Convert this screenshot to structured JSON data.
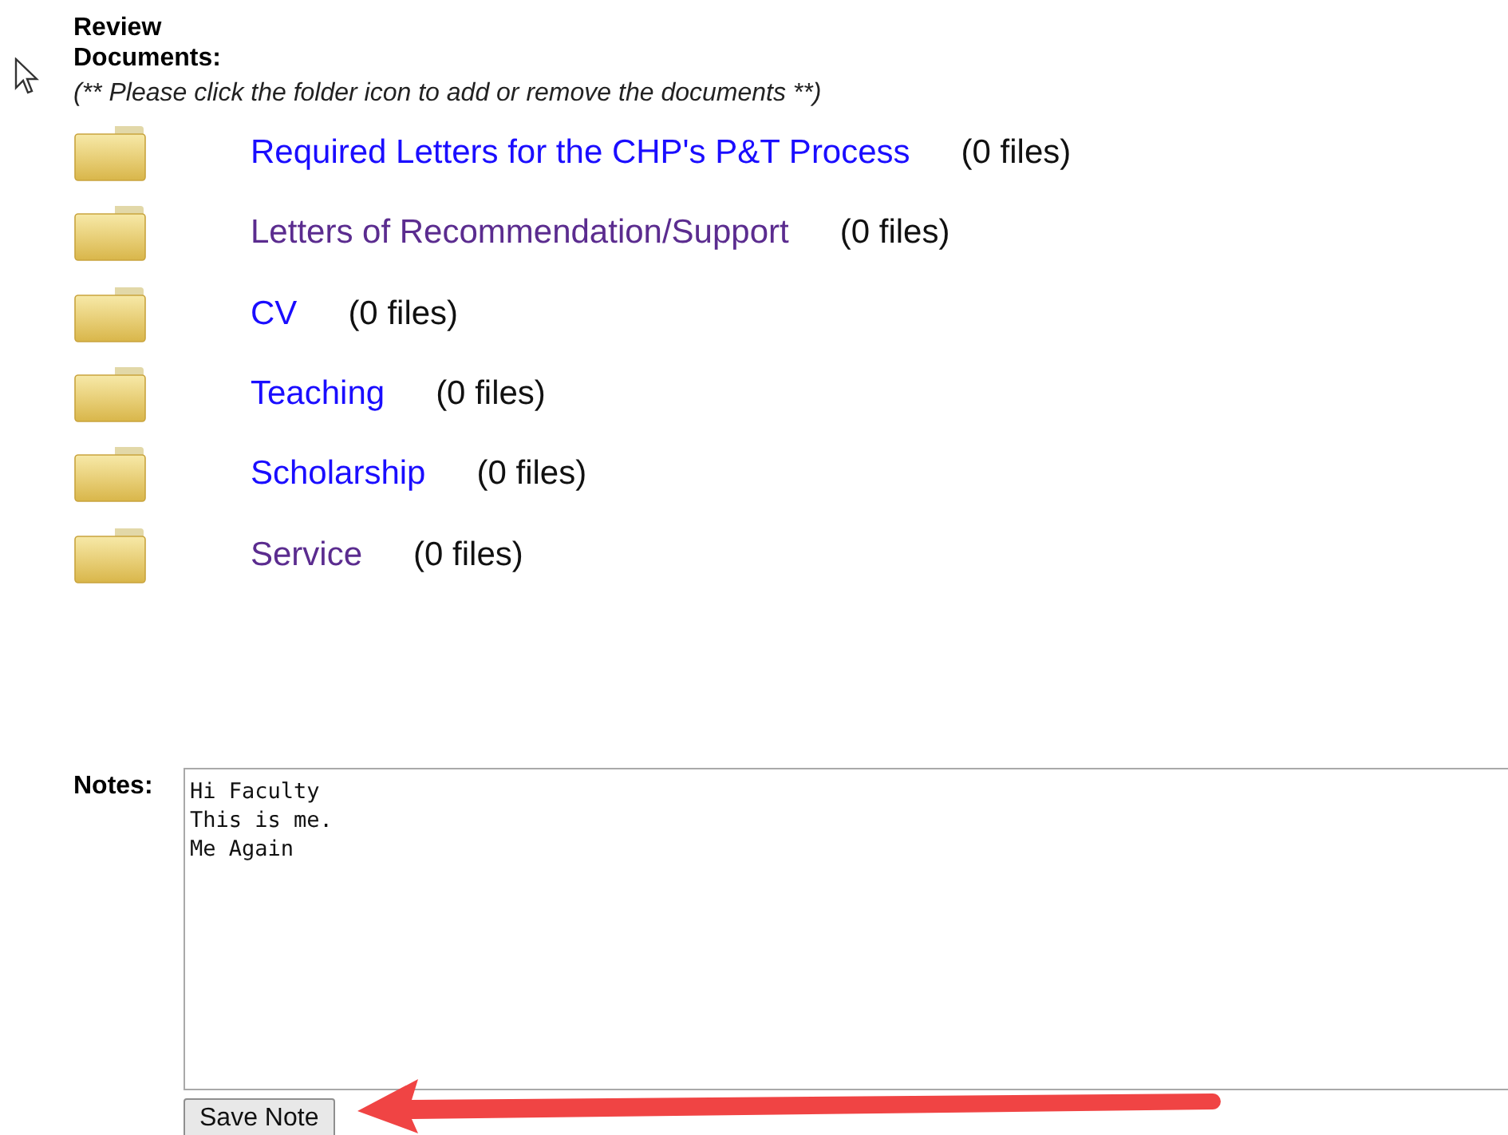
{
  "heading": "Review Documents:",
  "note": "(** Please click the folder icon to add or remove the documents **)",
  "folders": [
    {
      "label": "Required Letters for the CHP's P&T Process",
      "count": "(0 files)",
      "visited": false
    },
    {
      "label": "Letters of Recommendation/Support",
      "count": "(0 files)",
      "visited": true
    },
    {
      "label": "CV",
      "count": "(0 files)",
      "visited": false
    },
    {
      "label": "Teaching",
      "count": "(0 files)",
      "visited": false
    },
    {
      "label": "Scholarship",
      "count": "(0 files)",
      "visited": false
    },
    {
      "label": "Service",
      "count": "(0 files)",
      "visited": true
    }
  ],
  "notes": {
    "label": "Notes:",
    "value": "Hi Faculty\nThis is me.\nMe Again"
  },
  "save_button": "Save Note"
}
